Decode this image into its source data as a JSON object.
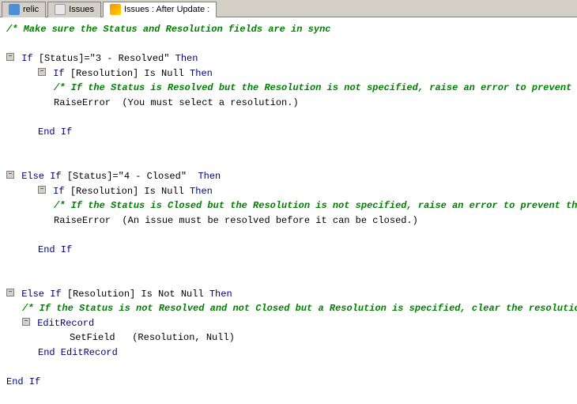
{
  "tabs": [
    {
      "id": "relic",
      "label": "relic",
      "active": false,
      "icon": "relic"
    },
    {
      "id": "issues",
      "label": "Issues",
      "active": false,
      "icon": "issues"
    },
    {
      "id": "issues-after-update",
      "label": "Issues : After Update :",
      "active": true,
      "icon": "active"
    }
  ],
  "code": {
    "comment1": "/*    Make sure the Status and Resolution fields are in sync",
    "line1_if": "If",
    "line1_cond": "[Status]=\"3 - Resolved\"",
    "line1_then": "Then",
    "line2_if": "If",
    "line2_cond": "[Resolution] Is Null",
    "line2_then": "Then",
    "comment2": "/*     If the Status is Resolved but the Resolution is not specified, raise an error to prevent the data from bein",
    "raise1": "RaiseError",
    "raise1_msg": "(You must select a resolution.)",
    "endif1": "End If",
    "elseif1": "Else If",
    "elseif1_cond": "[Status]=\"4 - Closed\"",
    "elseif1_then": "Then",
    "line3_if": "If",
    "line3_cond": "[Resolution] Is Null",
    "line3_then": "Then",
    "comment3": "/*     If the Status is Closed but the Resolution is not specified, raise an error to prevent the data from being",
    "raise2": "RaiseError",
    "raise2_msg": "(An issue must be resolved before it can be closed.)",
    "endif2": "End If",
    "elseif2": "Else If",
    "elseif2_cond": "[Resolution] Is Not Null",
    "elseif2_then": "Then",
    "comment4": "/*    If the Status is not Resolved and not Closed but a Resolution is specified, clear the resolution",
    "editrecord": "EditRecord",
    "setfield": "SetField",
    "setfield_args": "(Resolution, Null)",
    "end_editrecord": "End EditRecord",
    "endif3": "End If"
  }
}
